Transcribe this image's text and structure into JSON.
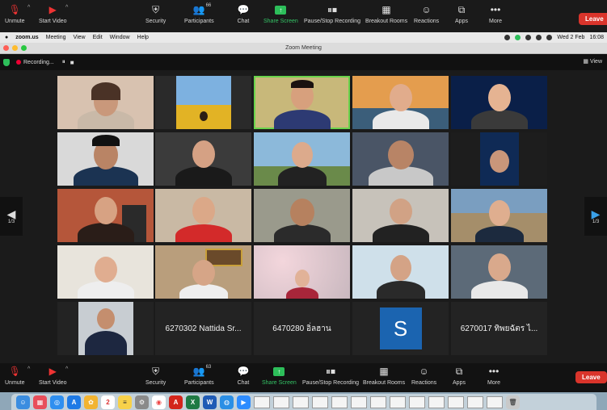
{
  "toolbar": {
    "unmute": "Unmute",
    "start_video": "Start Video",
    "security": "Security",
    "participants": "Participants",
    "participants_count_top": "66",
    "participants_count_bottom": "63",
    "chat": "Chat",
    "share_screen": "Share Screen",
    "recording": "Pause/Stop Recording",
    "breakout": "Breakout Rooms",
    "reactions": "Reactions",
    "apps": "Apps",
    "more": "More",
    "leave": "Leave"
  },
  "menubar": {
    "app": "zoom.us",
    "items": [
      "Meeting",
      "View",
      "Edit",
      "Window",
      "Help"
    ],
    "date": "Wed 2 Feb",
    "time": "16:08"
  },
  "window": {
    "title": "Zoom Meeting"
  },
  "recording_strip": {
    "label": "Recording...",
    "view": "View"
  },
  "pagination": {
    "left": "1/3",
    "right": "1/3"
  },
  "tiles": {
    "name_1": "6270302 Nattida Sr...",
    "name_2": "6470280 อิ่ลฮาน",
    "avatar_letter": "S",
    "name_3": "6270017 ทิพยฉัตร ไ..."
  },
  "colors": {
    "accent_green": "#2dbe5a",
    "leave_red": "#d9342b",
    "avatar_blue": "#1b64b0"
  },
  "icons": [
    "microphone-muted-icon",
    "video-off-icon",
    "shield-icon",
    "participants-icon",
    "chat-icon",
    "share-screen-icon",
    "pause-icon",
    "stop-icon",
    "breakout-icon",
    "reactions-icon",
    "apps-icon",
    "more-icon"
  ]
}
